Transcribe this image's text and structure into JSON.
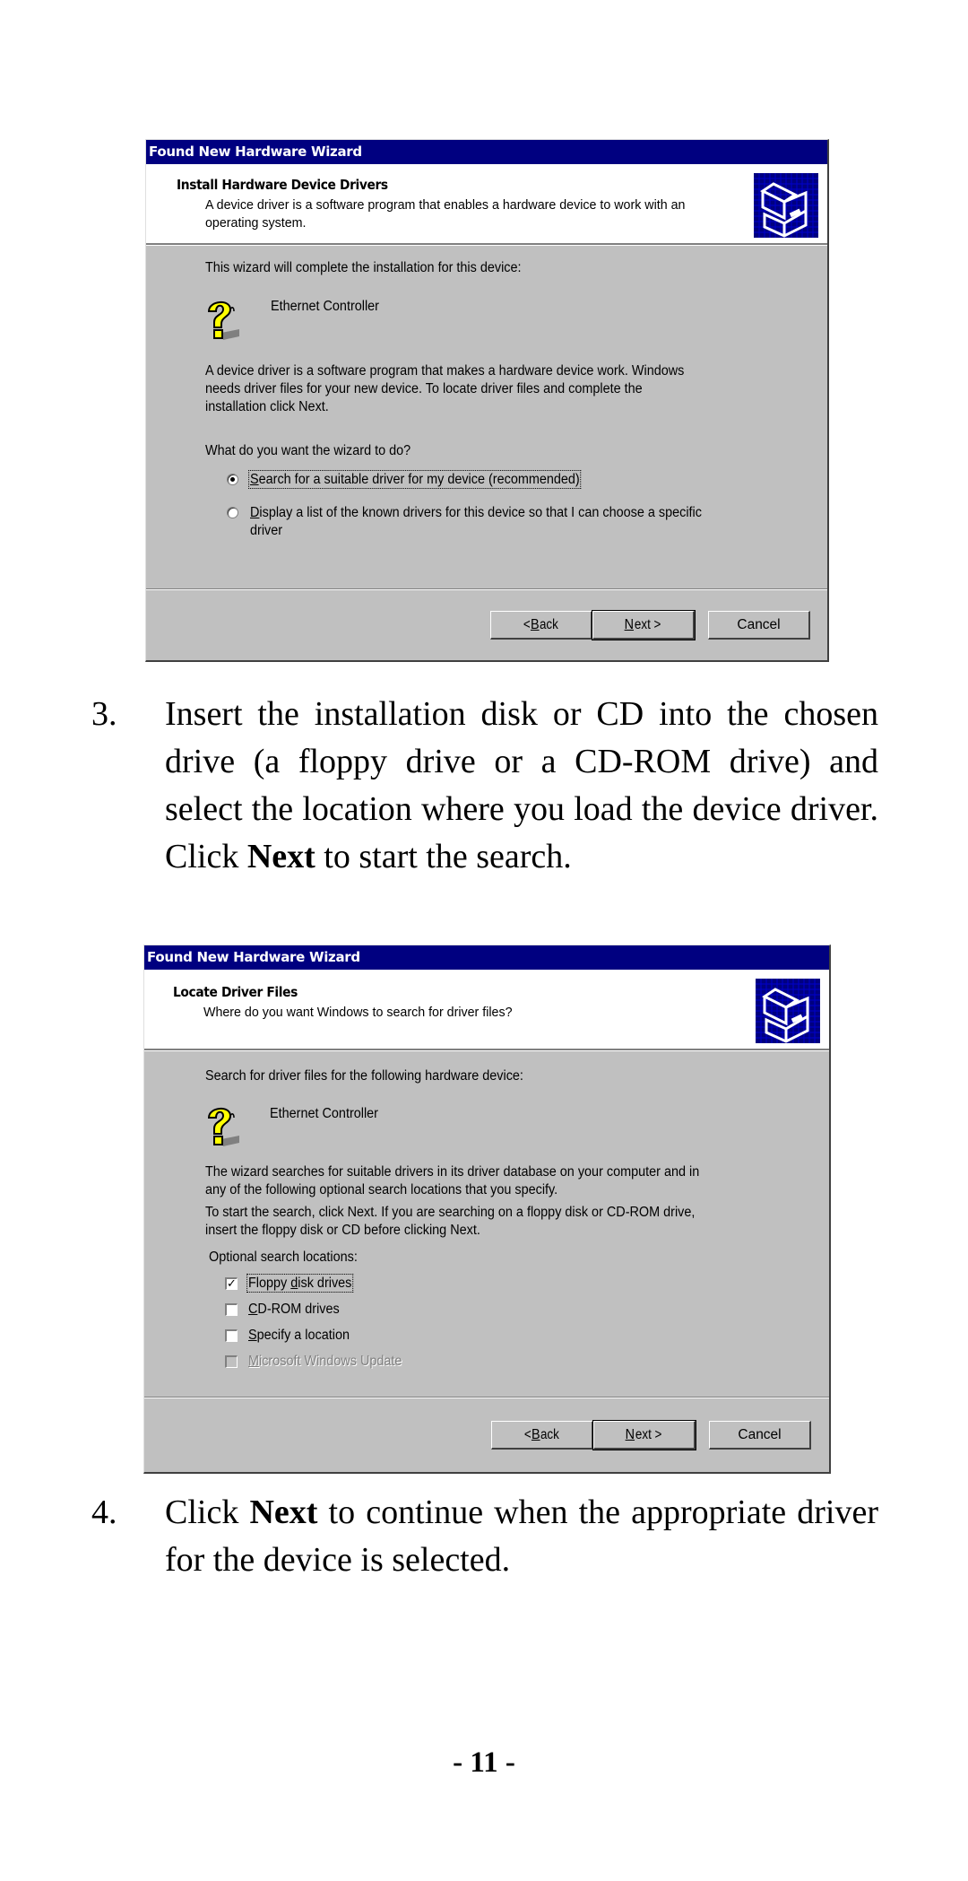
{
  "dialog1": {
    "title": "Found New Hardware Wizard",
    "header_title": "Install Hardware Device Drivers",
    "header_subtitle": "A device driver is a software program that enables a hardware device to work with an operating system.",
    "intro": "This wizard will complete the installation for this device:",
    "device_name": "Ethernet Controller",
    "description_lines": [
      "A device driver is a software program that makes a hardware device work. Windows",
      "needs driver files for your new device. To locate driver files and complete the",
      "installation click Next."
    ],
    "question": "What do you want the wizard to do?",
    "options": [
      {
        "accel": "S",
        "rest": "earch for a suitable driver for my device (recommended)",
        "selected": true
      },
      {
        "accel": "D",
        "rest": "isplay a list of the known drivers for this device so that I can choose a specific",
        "line2": "driver",
        "selected": false
      }
    ],
    "buttons": {
      "back_prefix": "< ",
      "back_accel": "B",
      "back_rest": "ack",
      "next_accel": "N",
      "next_rest": "ext >",
      "cancel": "Cancel"
    }
  },
  "step3": {
    "number": "3.",
    "text_before": "Insert the installation disk or CD into the chosen drive (a floppy drive or a CD-ROM drive) and select the location where you load the device driver. Click ",
    "bold": "Next",
    "text_after": " to start the search."
  },
  "dialog2": {
    "title": "Found New Hardware Wizard",
    "header_title": "Locate Driver Files",
    "header_subtitle": "Where do you want Windows to search for driver files?",
    "intro": "Search for driver files for the following hardware device:",
    "device_name": "Ethernet Controller",
    "description1_lines": [
      "The wizard searches for suitable drivers in its driver database on your computer and in",
      "any of the following optional search locations that you specify."
    ],
    "description2_lines": [
      "To start the search, click Next. If you are searching on a floppy disk or CD-ROM drive,",
      "insert the floppy disk or CD before clicking Next."
    ],
    "locations_label": "Optional search locations:",
    "locations": [
      {
        "pre": "Floppy ",
        "accel": "d",
        "rest": "isk drives",
        "checked": true,
        "enabled": true
      },
      {
        "pre": "",
        "accel": "C",
        "rest": "D-ROM drives",
        "checked": false,
        "enabled": true
      },
      {
        "pre": "",
        "accel": "S",
        "rest": "pecify a location",
        "checked": false,
        "enabled": true
      },
      {
        "pre": "",
        "accel": "M",
        "rest": "icrosoft Windows Update",
        "checked": false,
        "enabled": false
      }
    ],
    "buttons": {
      "back_prefix": "< ",
      "back_accel": "B",
      "back_rest": "ack",
      "next_accel": "N",
      "next_rest": "ext >",
      "cancel": "Cancel"
    }
  },
  "step4": {
    "number": "4.",
    "text_before": "Click ",
    "bold": "Next",
    "text_after": " to continue when the appropriate driver for the device is selected."
  },
  "page_number": "- 11 -",
  "colors": {
    "titlebar": "#000080",
    "dialog_face": "#c0c0c0",
    "icon_yellow": "#ffff00"
  }
}
